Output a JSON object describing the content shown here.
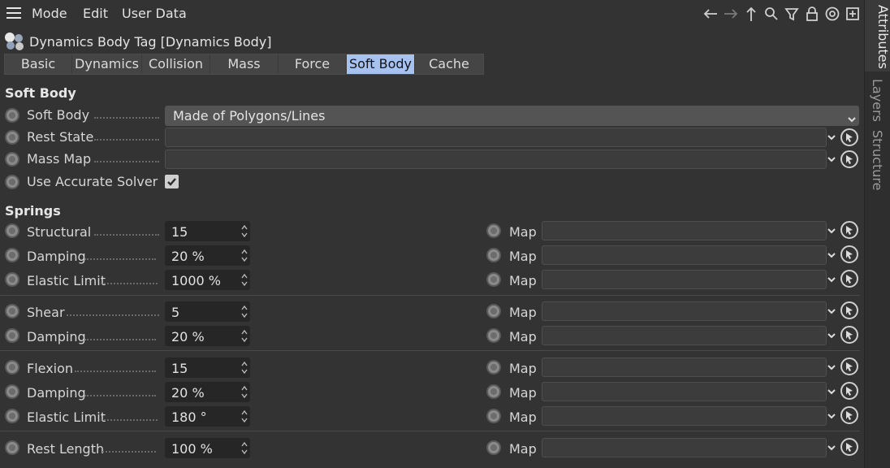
{
  "menu": {
    "items": [
      "Mode",
      "Edit",
      "User Data"
    ]
  },
  "toolbar": {
    "icons": [
      "back-arrow-icon",
      "forward-arrow-icon",
      "up-arrow-icon",
      "search-icon",
      "filter-icon",
      "lock-icon",
      "target-icon",
      "new-window-icon"
    ]
  },
  "header": {
    "title": "Dynamics Body Tag [Dynamics Body]"
  },
  "tabs": [
    {
      "label": "Basic"
    },
    {
      "label": "Dynamics"
    },
    {
      "label": "Collision"
    },
    {
      "label": "Mass"
    },
    {
      "label": "Force"
    },
    {
      "label": "Soft Body",
      "active": true
    },
    {
      "label": "Cache"
    }
  ],
  "soft_body": {
    "heading": "Soft Body",
    "soft_body_label": "Soft Body",
    "soft_body_value": "Made of Polygons/Lines",
    "rest_state_label": "Rest State",
    "mass_map_label": "Mass Map",
    "accurate_solver_label": "Use Accurate Solver",
    "accurate_solver_checked": true
  },
  "springs": {
    "heading": "Springs",
    "map_label": "Map",
    "rows": [
      {
        "label": "Structural",
        "value": "15"
      },
      {
        "label": "Damping",
        "value": "20 %"
      },
      {
        "label": "Elastic Limit",
        "value": "1000 %"
      },
      {
        "label": "Shear",
        "value": "5"
      },
      {
        "label": "Damping",
        "value": "20 %"
      },
      {
        "label": "Flexion",
        "value": "15"
      },
      {
        "label": "Damping",
        "value": "20 %"
      },
      {
        "label": "Elastic Limit",
        "value": "180 °"
      },
      {
        "label": "Rest Length",
        "value": "100 %"
      }
    ]
  },
  "side_tabs": [
    {
      "label": "Attributes",
      "active": true
    },
    {
      "label": "Layers"
    },
    {
      "label": "Structure"
    }
  ],
  "colors": {
    "active_tab": "#a8c2f0",
    "background": "#333333"
  }
}
